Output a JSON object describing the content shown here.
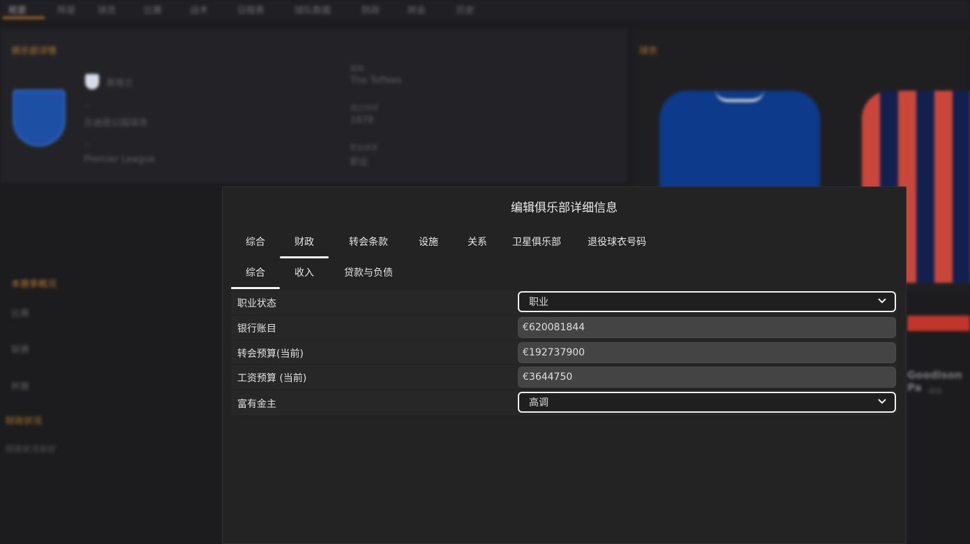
{
  "background": {
    "nav_items": [
      "概要",
      "阵容",
      "球员",
      "比赛",
      "战术",
      "日程表",
      "球队数据",
      "财政",
      "转会",
      "历史"
    ],
    "club_section_title": "俱乐部详情",
    "kit_section_title": "球衣",
    "club_field_nickname_label": "昵称",
    "club_field_nickname_value": "The Toffees",
    "club_field_founded_label": "成立时间",
    "club_field_founded_value": "1878",
    "club_field_status_label": "职业状态",
    "club_field_status_value": "职业",
    "club_field_city_value": "英格兰",
    "club_field_stadium_value": "古迪逊公园球场",
    "club_field_league_value": "Premier League",
    "left_section_title": "本赛季概况",
    "left_items": [
      "比赛",
      "联赛",
      "杯赛"
    ],
    "left_bottom_title": "财政状况",
    "left_bottom_text": "财政状况良好",
    "right_player_text": "Goodison Pa",
    "right_caption": "球场"
  },
  "modal": {
    "title": "编辑俱乐部详细信息",
    "tabs": [
      {
        "label": "综合",
        "active": false
      },
      {
        "label": "财政",
        "active": true
      },
      {
        "label": "转会条款",
        "active": false
      },
      {
        "label": "设施",
        "active": false
      },
      {
        "label": "关系",
        "active": false
      },
      {
        "label": "卫星俱乐部",
        "active": false
      },
      {
        "label": "退役球衣号码",
        "active": false
      }
    ],
    "subtabs": [
      {
        "label": "综合",
        "active": true
      },
      {
        "label": "收入",
        "active": false
      },
      {
        "label": "贷款与负债",
        "active": false
      }
    ],
    "fields": {
      "status": {
        "label": "职业状态",
        "value": "职业"
      },
      "bank": {
        "label": "银行账目",
        "currency": "€",
        "value": "620081844"
      },
      "transfer_budget": {
        "label": "转会预算(当前)",
        "currency": "€",
        "value": "192737900"
      },
      "wage_budget": {
        "label": "工资预算 (当前)",
        "currency": "€",
        "value": "3644750"
      },
      "sugar_daddy": {
        "label": "富有金主",
        "value": "高调"
      }
    }
  },
  "colors": {
    "accent_orange": "#b8702a",
    "modal_bg": "#232323",
    "input_bg": "#444444",
    "select_border": "#f0f0f0"
  }
}
